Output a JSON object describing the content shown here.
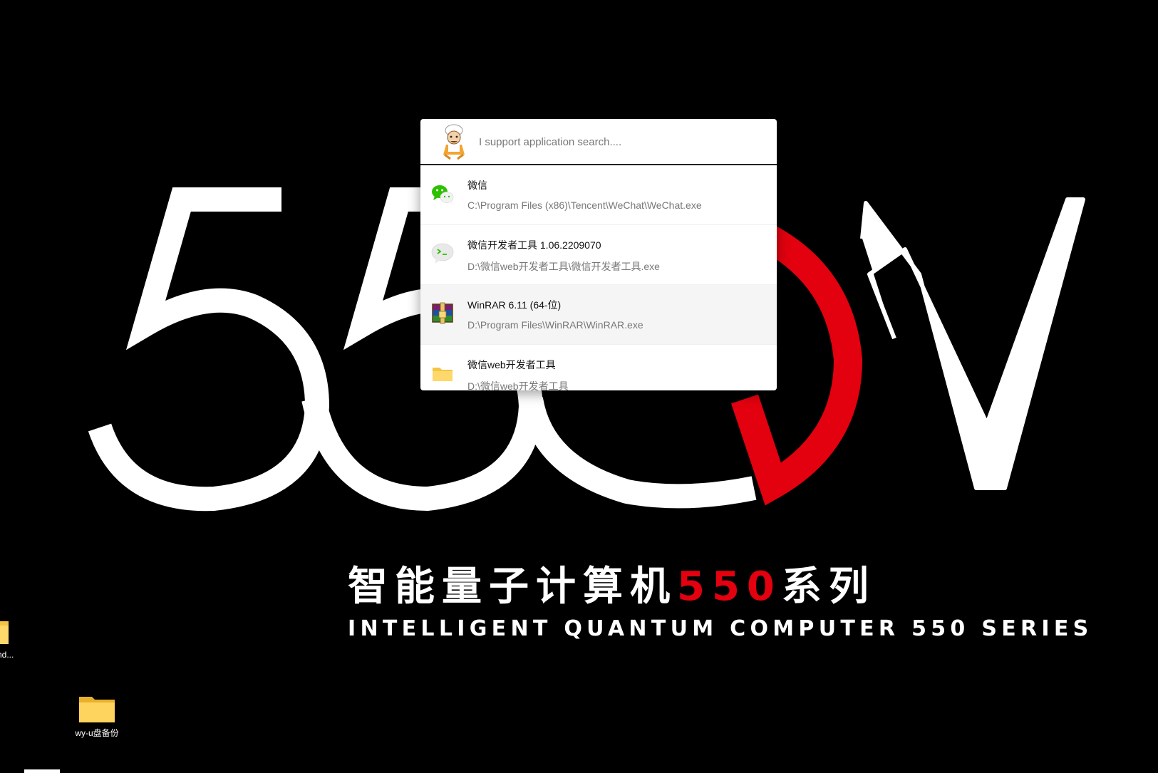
{
  "wallpaper": {
    "big_text": "550W",
    "title_zh_main": "智能量子计算机",
    "title_zh_number": "550",
    "title_zh_suffix": "系列",
    "title_en": "INTELLIGENT QUANTUM COMPUTER 550 SERIES",
    "colors": {
      "background": "#000000",
      "white": "#ffffff",
      "accent": "#e3000f"
    }
  },
  "launcher": {
    "avatar_icon": "cartoon-avatar-icon",
    "search_placeholder": "I support application search....",
    "search_value": "",
    "results": [
      {
        "icon": "wechat-icon",
        "name": "微信",
        "path": "C:\\Program Files (x86)\\Tencent\\WeChat\\WeChat.exe",
        "selected": false
      },
      {
        "icon": "wechat-devtools-icon",
        "name": "微信开发者工具 1.06.2209070",
        "path": "D:\\微信web开发者工具\\微信开发者工具.exe",
        "selected": false
      },
      {
        "icon": "winrar-icon",
        "name": "WinRAR 6.11 (64-位)",
        "path": "D:\\Program Files\\WinRAR\\WinRAR.exe",
        "selected": true
      },
      {
        "icon": "folder-icon",
        "name": "微信web开发者工具",
        "path": "D:\\微信web开发者工具",
        "selected": false
      }
    ]
  },
  "desktop_icons": [
    {
      "icon": "folder-icon",
      "label": "nd..."
    },
    {
      "icon": "folder-icon",
      "label": "wy-u盘备份"
    }
  ]
}
